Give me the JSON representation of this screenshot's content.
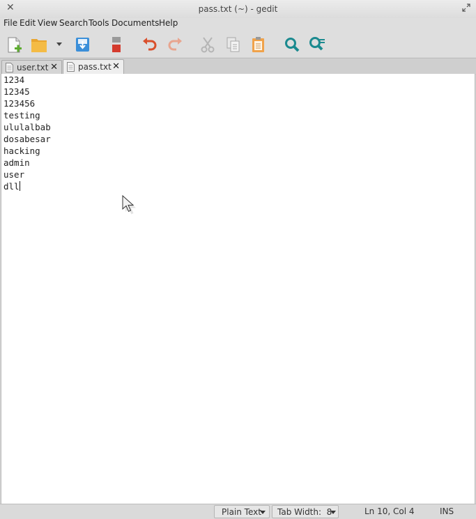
{
  "window": {
    "title": "pass.txt (~) - gedit"
  },
  "menu": [
    "File",
    "Edit",
    "View",
    "Search",
    "Tools",
    "Documents",
    "Help"
  ],
  "tabs": [
    {
      "label": "user.txt",
      "active": false
    },
    {
      "label": "pass.txt",
      "active": true
    }
  ],
  "editor": {
    "lines": [
      "1234",
      "12345",
      "123456",
      "testing",
      "ululalbab",
      "dosabesar",
      "hacking",
      "admin",
      "user",
      "dll"
    ]
  },
  "status": {
    "language": "Plain Text",
    "tab_width": "Tab Width:  8",
    "position": "Ln 10, Col 4",
    "mode": "INS"
  },
  "colors": {
    "accent_green": "#5cac2d",
    "folder": "#f2b33b",
    "save_blue": "#3b8fd9",
    "undo": "#d9502c",
    "search": "#1b8a8f"
  }
}
